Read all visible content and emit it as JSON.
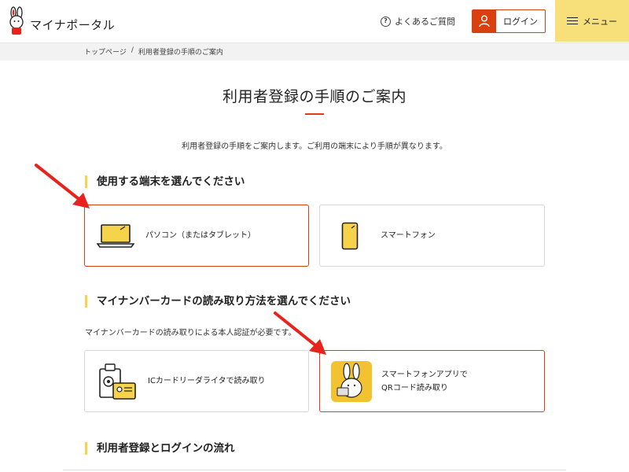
{
  "header": {
    "logo_text": "マイナポータル",
    "faq_label": "よくあるご質問",
    "login_label": "ログイン",
    "menu_label": "メニュー"
  },
  "breadcrumb": {
    "home": "トップページ",
    "separator": "/",
    "current": "利用者登録の手順のご案内"
  },
  "page": {
    "title": "利用者登録の手順のご案内",
    "intro": "利用者登録の手順をご案内します。ご利用の端末により手順が異なります。"
  },
  "sections": {
    "device": {
      "heading": "使用する端末を選んでください",
      "options": [
        {
          "label": "パソコン（またはタブレット）",
          "icon": "laptop-icon",
          "selected": true
        },
        {
          "label": "スマートフォン",
          "icon": "smartphone-icon",
          "selected": false
        }
      ]
    },
    "reading": {
      "heading": "マイナンバーカードの読み取り方法を選んでください",
      "note": "マイナンバーカードの読み取りによる本人認証が必要です。",
      "options": [
        {
          "label": "ICカードリーダライタで読み取り",
          "icon": "card-reader-icon",
          "selected": false
        },
        {
          "label_line1": "スマートフォンアプリで",
          "label_line2": "QRコード読み取り",
          "icon": "mascot-app-icon",
          "selected": true
        }
      ]
    },
    "flow": {
      "heading": "利用者登録とログインの流れ"
    }
  },
  "colors": {
    "accent": "#d9400f",
    "menu_bg": "#f7e07a",
    "heading_bar": "#f7d24b",
    "arrow": "#e8231d"
  }
}
